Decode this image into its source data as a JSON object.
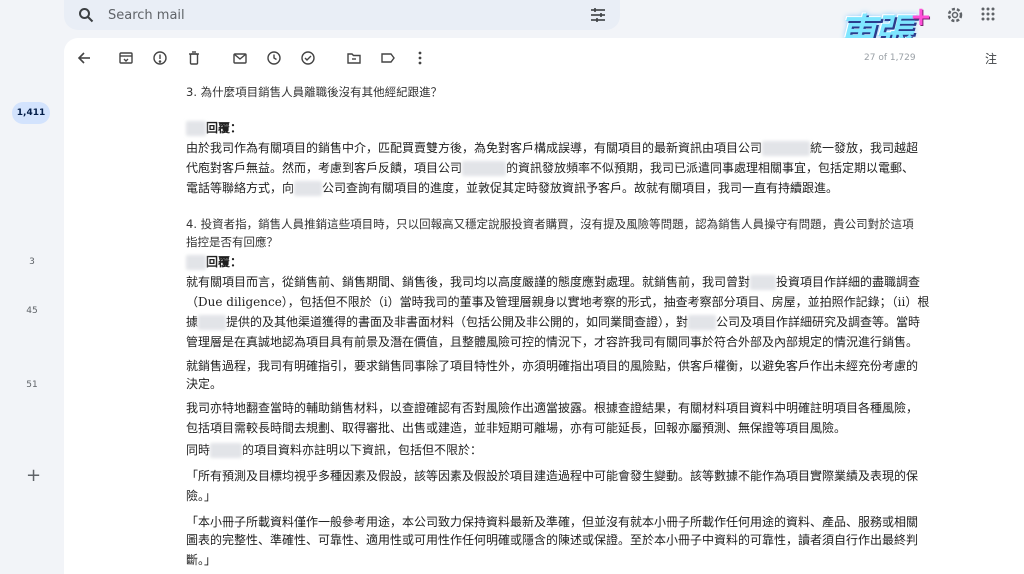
{
  "search": {
    "placeholder": "Search mail"
  },
  "brand": {
    "text": "東張",
    "plus": "+"
  },
  "rail": {
    "inbox_count": "1,411",
    "counts": [
      "3",
      "45",
      "51"
    ]
  },
  "toolbar": {
    "icons": [
      "back-arrow-icon",
      "archive-icon",
      "report-icon",
      "delete-icon",
      "mark-unread-icon",
      "snooze-icon",
      "add-task-icon",
      "move-to-icon",
      "label-icon",
      "more-icon"
    ]
  },
  "pager": "27 of 1,729",
  "lang_icon_label": "注",
  "doc": {
    "q3": "3.    為什麼項目銷售人員離職後沒有其他經紀跟進？",
    "a3_label": "回覆：",
    "a3_l1a": "由於我司作為有關項目的銷售中介，匹配買賣雙方後，為免對客戶構成誤導，有關項目的最新資訊由項目公司",
    "a3_l1b": "統一發放，我司越超",
    "a3_l2a": "代庖對客戶無益。然而，考慮到客戶反饋，項目公司",
    "a3_l2b": "的資訊發放頻率不似預期，我司已派遣同事處理相關事宜，包括定期以電郵、",
    "a3_l3a": "電話等聯絡方式，向",
    "a3_l3b": "公司查詢有關項目的進度，並敦促其定時發放資訊予客戶。故就有關項目，我司一直有持續跟進。",
    "q4_l1": "4.    投資者指，銷售人員推銷這些項目時，只以回報高又穩定說服投資者購買，沒有提及風險等問題，認為銷售人員操守有問題，貴公司對於這項",
    "q4_l2": "指控是否有回應？",
    "a4_label": "回覆：",
    "a4_p1_l1a": "就有關項目而言，從銷售前、銷售期間、銷售後，我司均以高度嚴謹的態度應對處理。就銷售前，我司曾對",
    "a4_p1_l1b": "投資項目作詳細的盡職調查",
    "a4_p1_l2": "（Due diligence），包括但不限於（i）當時我司的董事及管理層親身以實地考察的形式，抽查考察部分項目、房屋，並拍照作記錄；（ii）根",
    "a4_p1_l3a": "據",
    "a4_p1_l3b": "提供的及其他渠道獲得的書面及非書面材料（包括公開及非公開的，如同業間查證），對",
    "a4_p1_l3c": "公司及項目作詳細研究及調查等。當時",
    "a4_p1_l4": "管理層是在真誠地認為項目具有前景及潛在價值，且整體風險可控的情況下，才容許我司有關同事於符合外部及內部規定的情況進行銷售。",
    "a4_p2_l1": "就銷售過程，我司有明確指引，要求銷售同事除了項目特性外，亦須明確指出項目的風險點，供客戶權衡，以避免客戶作出未經充份考慮的",
    "a4_p2_l2": "決定。",
    "a4_p3_l1": "我司亦特地翻查當時的輔助銷售材料，以查證確認有否對風險作出適當披露。根據查證結果，有關材料項目資料中明確註明項目各種風險，",
    "a4_p3_l2": "包括項目需較長時間去規劃、取得審批、出售或建造，並非短期可離場，亦有可能延長，回報亦屬預測、無保證等項目風險。",
    "a4_p4_a": "同時",
    "a4_p4_b": "的項目資料亦註明以下資訊，包括但不限於：",
    "a4_p5_l1": "「所有預測及目標均視乎多種因素及假設，該等因素及假設於項目建造過程中可能會發生變動。該等數據不能作為項目實際業績及表現的保",
    "a4_p5_l2": "險。」",
    "a4_p6_l1": "「本小冊子所載資料僅作一般參考用途，本公司致力保持資料最新及準確，但並沒有就本小冊子所載作任何用途的資料、產品、服務或相關",
    "a4_p6_l2": "圖表的完整性、準確性、可靠性、適用性或可用性作任何明確或隱含的陳述或保證。至於本小冊子中資料的可靠性，讀者須自行作出最終判",
    "a4_p6_l3": "斷。」"
  }
}
